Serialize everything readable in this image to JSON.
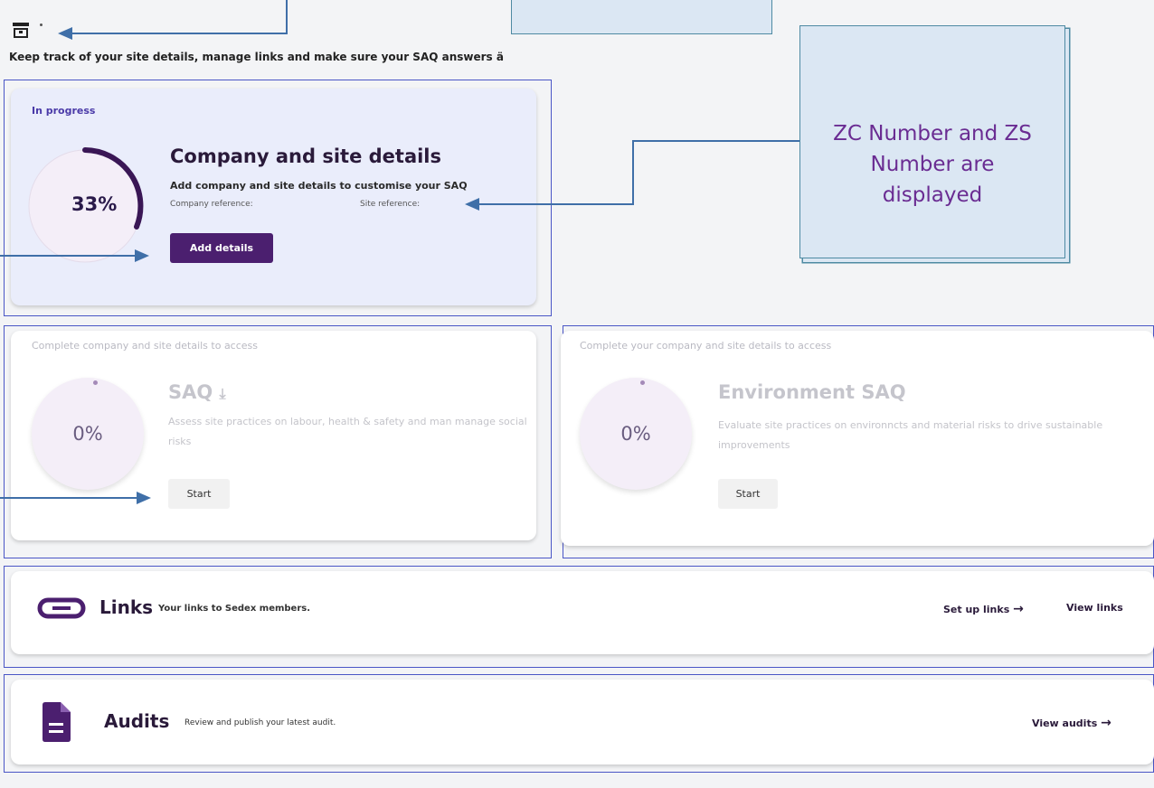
{
  "header": {
    "subtitle": "Keep track of your site details, manage links and make sure your SAQ answers ä"
  },
  "company_card": {
    "status": "In progress",
    "progress_percent": 33,
    "progress_label": "33%",
    "title": "Company and site details",
    "description": "Add company and site details to customise your SAQ",
    "company_reference_label": "Company reference:",
    "site_reference_label": "Site reference:",
    "button_label": "Add details"
  },
  "saq_card": {
    "status": "Complete company and site details to access",
    "progress_label": "0%",
    "title": "SAQ",
    "description": "Assess site practices on labour, health & safety and man manage social risks",
    "button_label": "Start"
  },
  "env_card": {
    "status": "Complete your company and site details to access",
    "progress_label": "0%",
    "title": "Environment SAQ",
    "description": "Evaluate site practices on environncts and material risks to drive sustainable improvements",
    "button_label": "Start"
  },
  "links_row": {
    "title": "Links",
    "description": "Your links to Sedex members.",
    "setup_label": "Set up links",
    "view_label": "View links"
  },
  "audits_row": {
    "title": "Audits",
    "description": "Review and publish your latest audit.",
    "view_label": "View audits"
  },
  "annotation": {
    "note": "ZC Number and ZS Number are displayed"
  },
  "colors": {
    "brand_purple": "#4b1f6f",
    "annotation_outline": "#4a56c6",
    "arrow": "#3f6fa8",
    "note_text": "#6a2c92"
  }
}
